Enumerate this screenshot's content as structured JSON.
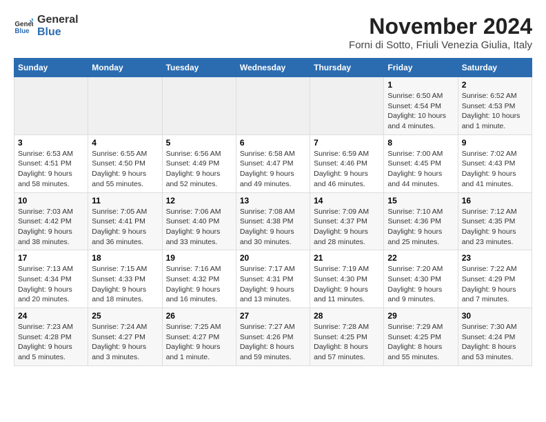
{
  "logo": {
    "text_general": "General",
    "text_blue": "Blue"
  },
  "title": "November 2024",
  "subtitle": "Forni di Sotto, Friuli Venezia Giulia, Italy",
  "days_of_week": [
    "Sunday",
    "Monday",
    "Tuesday",
    "Wednesday",
    "Thursday",
    "Friday",
    "Saturday"
  ],
  "weeks": [
    [
      {
        "day": "",
        "info": ""
      },
      {
        "day": "",
        "info": ""
      },
      {
        "day": "",
        "info": ""
      },
      {
        "day": "",
        "info": ""
      },
      {
        "day": "",
        "info": ""
      },
      {
        "day": "1",
        "info": "Sunrise: 6:50 AM\nSunset: 4:54 PM\nDaylight: 10 hours and 4 minutes."
      },
      {
        "day": "2",
        "info": "Sunrise: 6:52 AM\nSunset: 4:53 PM\nDaylight: 10 hours and 1 minute."
      }
    ],
    [
      {
        "day": "3",
        "info": "Sunrise: 6:53 AM\nSunset: 4:51 PM\nDaylight: 9 hours and 58 minutes."
      },
      {
        "day": "4",
        "info": "Sunrise: 6:55 AM\nSunset: 4:50 PM\nDaylight: 9 hours and 55 minutes."
      },
      {
        "day": "5",
        "info": "Sunrise: 6:56 AM\nSunset: 4:49 PM\nDaylight: 9 hours and 52 minutes."
      },
      {
        "day": "6",
        "info": "Sunrise: 6:58 AM\nSunset: 4:47 PM\nDaylight: 9 hours and 49 minutes."
      },
      {
        "day": "7",
        "info": "Sunrise: 6:59 AM\nSunset: 4:46 PM\nDaylight: 9 hours and 46 minutes."
      },
      {
        "day": "8",
        "info": "Sunrise: 7:00 AM\nSunset: 4:45 PM\nDaylight: 9 hours and 44 minutes."
      },
      {
        "day": "9",
        "info": "Sunrise: 7:02 AM\nSunset: 4:43 PM\nDaylight: 9 hours and 41 minutes."
      }
    ],
    [
      {
        "day": "10",
        "info": "Sunrise: 7:03 AM\nSunset: 4:42 PM\nDaylight: 9 hours and 38 minutes."
      },
      {
        "day": "11",
        "info": "Sunrise: 7:05 AM\nSunset: 4:41 PM\nDaylight: 9 hours and 36 minutes."
      },
      {
        "day": "12",
        "info": "Sunrise: 7:06 AM\nSunset: 4:40 PM\nDaylight: 9 hours and 33 minutes."
      },
      {
        "day": "13",
        "info": "Sunrise: 7:08 AM\nSunset: 4:38 PM\nDaylight: 9 hours and 30 minutes."
      },
      {
        "day": "14",
        "info": "Sunrise: 7:09 AM\nSunset: 4:37 PM\nDaylight: 9 hours and 28 minutes."
      },
      {
        "day": "15",
        "info": "Sunrise: 7:10 AM\nSunset: 4:36 PM\nDaylight: 9 hours and 25 minutes."
      },
      {
        "day": "16",
        "info": "Sunrise: 7:12 AM\nSunset: 4:35 PM\nDaylight: 9 hours and 23 minutes."
      }
    ],
    [
      {
        "day": "17",
        "info": "Sunrise: 7:13 AM\nSunset: 4:34 PM\nDaylight: 9 hours and 20 minutes."
      },
      {
        "day": "18",
        "info": "Sunrise: 7:15 AM\nSunset: 4:33 PM\nDaylight: 9 hours and 18 minutes."
      },
      {
        "day": "19",
        "info": "Sunrise: 7:16 AM\nSunset: 4:32 PM\nDaylight: 9 hours and 16 minutes."
      },
      {
        "day": "20",
        "info": "Sunrise: 7:17 AM\nSunset: 4:31 PM\nDaylight: 9 hours and 13 minutes."
      },
      {
        "day": "21",
        "info": "Sunrise: 7:19 AM\nSunset: 4:30 PM\nDaylight: 9 hours and 11 minutes."
      },
      {
        "day": "22",
        "info": "Sunrise: 7:20 AM\nSunset: 4:30 PM\nDaylight: 9 hours and 9 minutes."
      },
      {
        "day": "23",
        "info": "Sunrise: 7:22 AM\nSunset: 4:29 PM\nDaylight: 9 hours and 7 minutes."
      }
    ],
    [
      {
        "day": "24",
        "info": "Sunrise: 7:23 AM\nSunset: 4:28 PM\nDaylight: 9 hours and 5 minutes."
      },
      {
        "day": "25",
        "info": "Sunrise: 7:24 AM\nSunset: 4:27 PM\nDaylight: 9 hours and 3 minutes."
      },
      {
        "day": "26",
        "info": "Sunrise: 7:25 AM\nSunset: 4:27 PM\nDaylight: 9 hours and 1 minute."
      },
      {
        "day": "27",
        "info": "Sunrise: 7:27 AM\nSunset: 4:26 PM\nDaylight: 8 hours and 59 minutes."
      },
      {
        "day": "28",
        "info": "Sunrise: 7:28 AM\nSunset: 4:25 PM\nDaylight: 8 hours and 57 minutes."
      },
      {
        "day": "29",
        "info": "Sunrise: 7:29 AM\nSunset: 4:25 PM\nDaylight: 8 hours and 55 minutes."
      },
      {
        "day": "30",
        "info": "Sunrise: 7:30 AM\nSunset: 4:24 PM\nDaylight: 8 hours and 53 minutes."
      }
    ]
  ]
}
